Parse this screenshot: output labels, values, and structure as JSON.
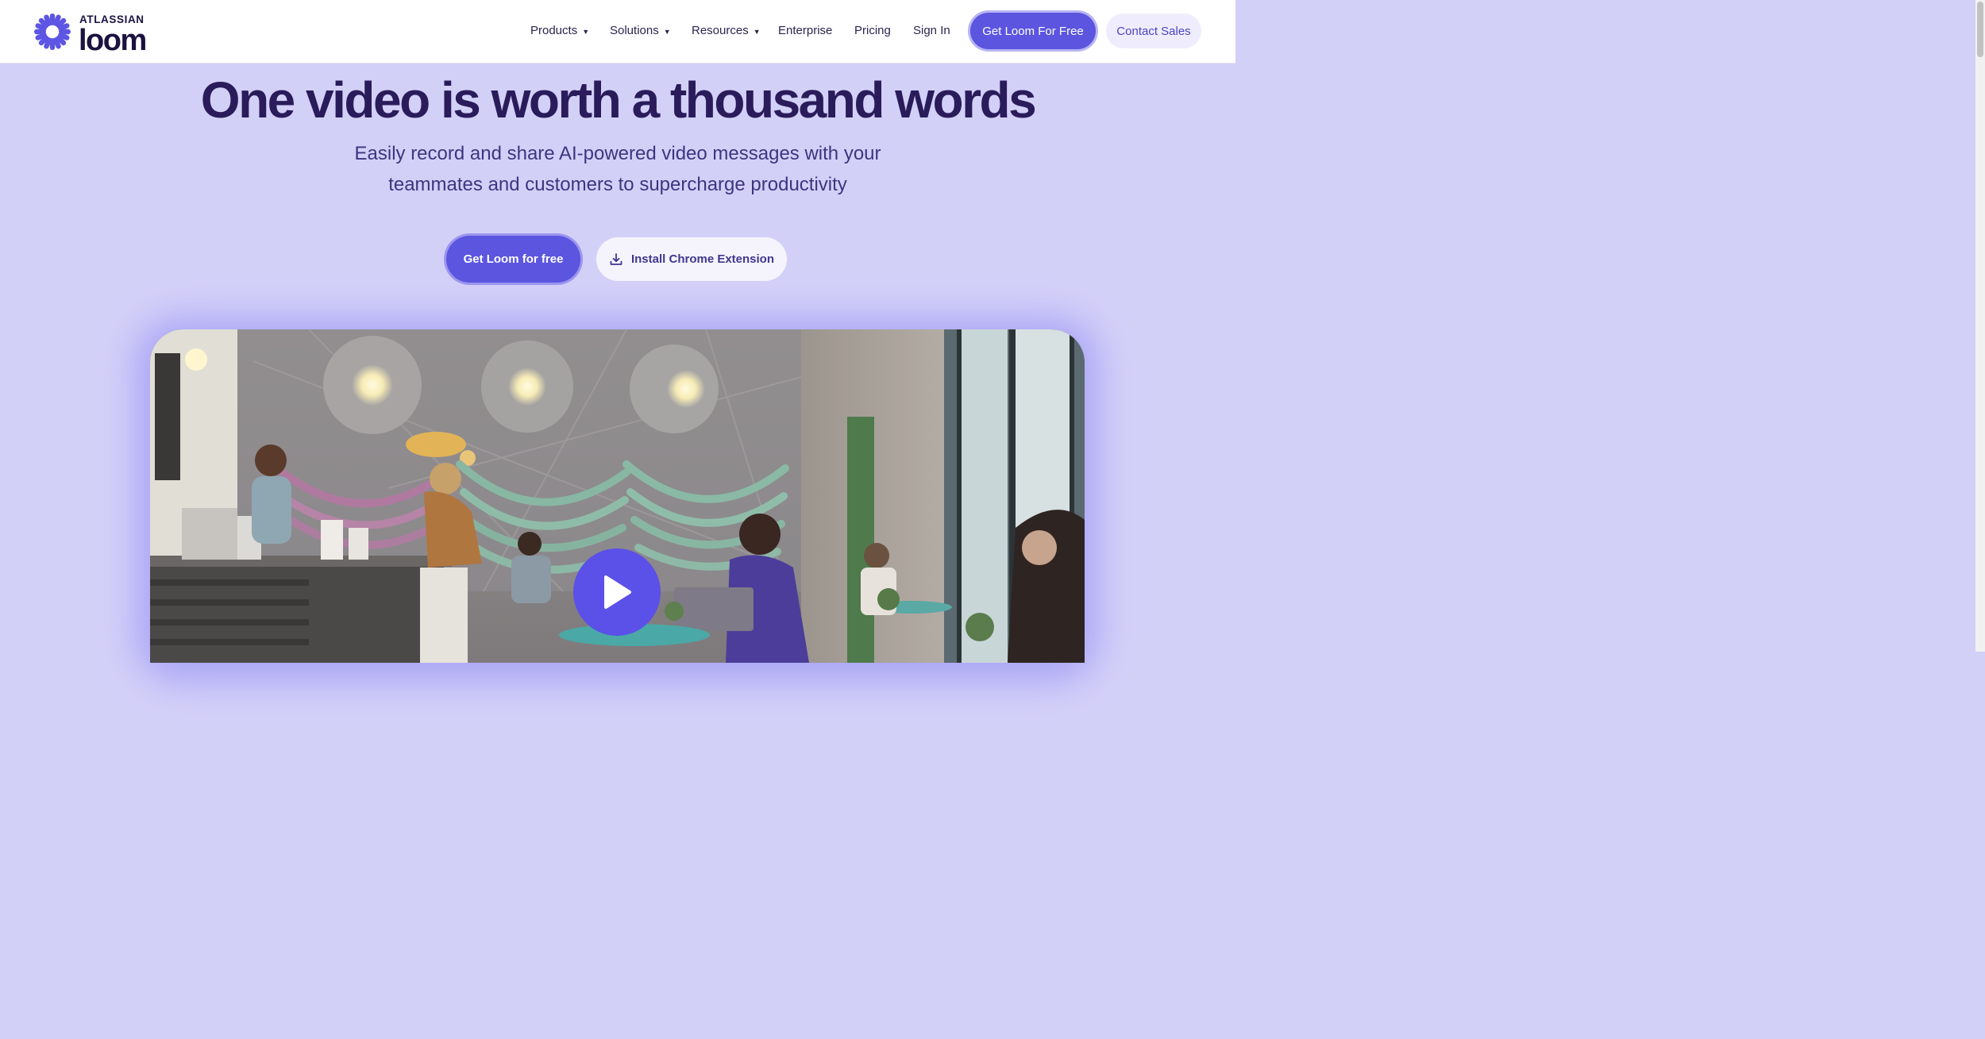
{
  "header": {
    "logo": {
      "top_text": "ATLASSIAN",
      "wordmark": "loom",
      "icon": "loom-burst-icon"
    },
    "nav": [
      {
        "label": "Products",
        "has_dropdown": true
      },
      {
        "label": "Solutions",
        "has_dropdown": true
      },
      {
        "label": "Resources",
        "has_dropdown": true
      },
      {
        "label": "Enterprise",
        "has_dropdown": false
      },
      {
        "label": "Pricing",
        "has_dropdown": false
      },
      {
        "label": "Sign In",
        "has_dropdown": false
      }
    ],
    "caret": "▼",
    "primary_button": "Get Loom For Free",
    "secondary_button": "Contact Sales"
  },
  "hero": {
    "title": "One video is worth a thousand words",
    "subtitle": "Easily record and share AI-powered video messages with your teammates and customers to supercharge productivity",
    "cta_primary": "Get Loom for free",
    "cta_secondary": "Install Chrome Extension",
    "cta_secondary_icon": "download-icon"
  },
  "video": {
    "play_icon": "play-icon"
  },
  "colors": {
    "page_background": "#d3d0f8",
    "brand_purple": "#5b55e0",
    "heading": "#2a1b5a",
    "subtitle": "#3d3580"
  }
}
